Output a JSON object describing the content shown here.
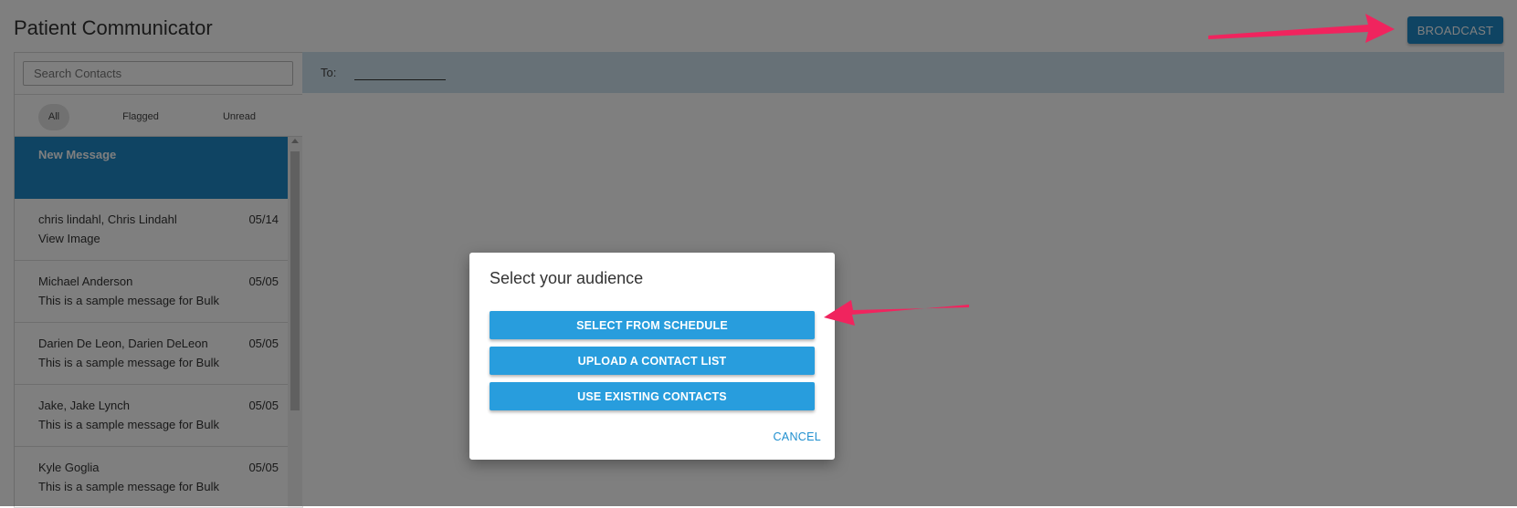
{
  "app": {
    "title": "Patient Communicator"
  },
  "header": {
    "broadcast_label": "BROADCAST"
  },
  "search": {
    "placeholder": "Search Contacts",
    "value": ""
  },
  "filters": [
    "All",
    "Flagged",
    "Unread"
  ],
  "threads": {
    "new_message": "New Message",
    "items": [
      {
        "name": "chris lindahl, Chris Lindahl",
        "date": "05/14",
        "preview": "View Image"
      },
      {
        "name": "Michael Anderson",
        "date": "05/05",
        "preview": "This is a sample message for Bulk"
      },
      {
        "name": "Darien De Leon, Darien DeLeon",
        "date": "05/05",
        "preview": "This is a sample message for Bulk"
      },
      {
        "name": "Jake, Jake Lynch",
        "date": "05/05",
        "preview": "This is a sample message for Bulk"
      },
      {
        "name": "Kyle Goglia",
        "date": "05/05",
        "preview": "This is a sample message for Bulk"
      }
    ]
  },
  "compose": {
    "to_label": "To:"
  },
  "dialog": {
    "title": "Select your audience",
    "buttons": [
      "SELECT FROM SCHEDULE",
      "UPLOAD A CONTACT LIST",
      "USE EXISTING CONTACTS"
    ],
    "cancel_label": "CANCEL"
  },
  "colors": {
    "primary": "#1e88c7",
    "dialog_button": "#289ddd",
    "annotation_arrow": "#f0245e",
    "overlay": "#000000"
  }
}
